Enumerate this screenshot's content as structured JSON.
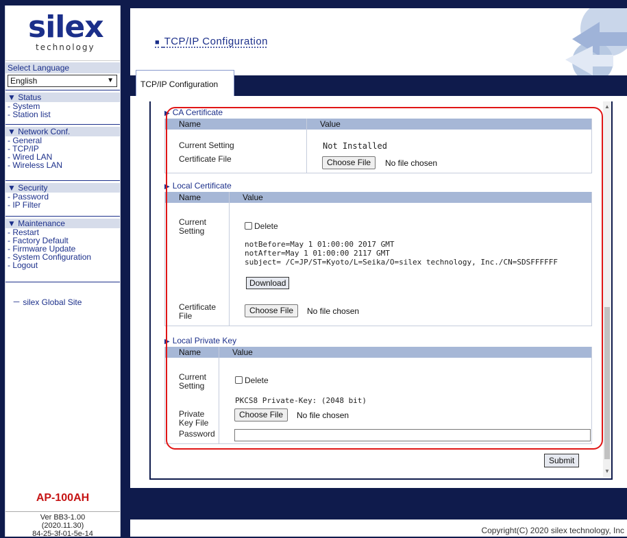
{
  "sidebar": {
    "logo_word": "silex",
    "logo_sub": "technology",
    "language_label": "Select Language",
    "language_value": "English",
    "sections": [
      {
        "head": "▼ Status",
        "items": [
          "- System",
          "- Station list"
        ]
      },
      {
        "head": "▼ Network Conf.",
        "items": [
          "- General",
          "- TCP/IP",
          "- Wired LAN",
          "- Wireless LAN"
        ]
      },
      {
        "head": "▼ Security",
        "items": [
          "- Password",
          "- IP Filter"
        ]
      },
      {
        "head": "▼ Maintenance",
        "items": [
          "- Restart",
          "- Factory Default",
          "- Firmware Update",
          "- System Configuration",
          "- Logout"
        ]
      }
    ],
    "global_site": "－ silex Global Site",
    "model": "AP-100AH",
    "version_lines": [
      "Ver BB3-1.00",
      "(2020.11.30)",
      "84-25-3f-01-5e-14"
    ]
  },
  "header": {
    "title_mark": "■",
    "title": "TCP/IP Configuration"
  },
  "tab": {
    "label": "TCP/IP Configuration"
  },
  "ca": {
    "title": "CA Certificate",
    "col_name": "Name",
    "col_value": "Value",
    "current_setting_label": "Current Setting",
    "current_setting_value": "Not Installed",
    "cert_file_label": "Certificate File",
    "choose_file": "Choose File",
    "no_file": "No file chosen"
  },
  "local_cert": {
    "title": "Local Certificate",
    "col_name": "Name",
    "col_value": "Value",
    "current_label_1": "Current",
    "current_label_2": "Setting",
    "delete_label": "Delete",
    "line1": "notBefore=May  1 01:00:00 2017 GMT",
    "line2": "notAfter=May  1 01:00:00 2117 GMT",
    "line3": "subject= /C=JP/ST=Kyoto/L=Seika/O=silex technology, Inc./CN=SDSFFFFFF",
    "download": "Download",
    "cert_file_1": "Certificate",
    "cert_file_2": "File",
    "choose_file": "Choose File",
    "no_file": "No file chosen"
  },
  "private_key": {
    "title": "Local Private Key",
    "col_name": "Name",
    "col_value": "Value",
    "current_label_1": "Current",
    "current_label_2": "Setting",
    "delete_label": "Delete",
    "key_info": "PKCS8 Private-Key: (2048 bit)",
    "file_label_1": "Private",
    "file_label_2": "Key File",
    "choose_file": "Choose File",
    "no_file": "No file chosen",
    "password_label": "Password",
    "password_value": ""
  },
  "submit": "Submit",
  "copyright": "Copyright(C) 2020 silex technology, Inc",
  "colors": {
    "navy": "#0f1b4c",
    "accent": "#1b2f8a",
    "highlight": "#e01515",
    "table_head": "#a6b7d6"
  }
}
